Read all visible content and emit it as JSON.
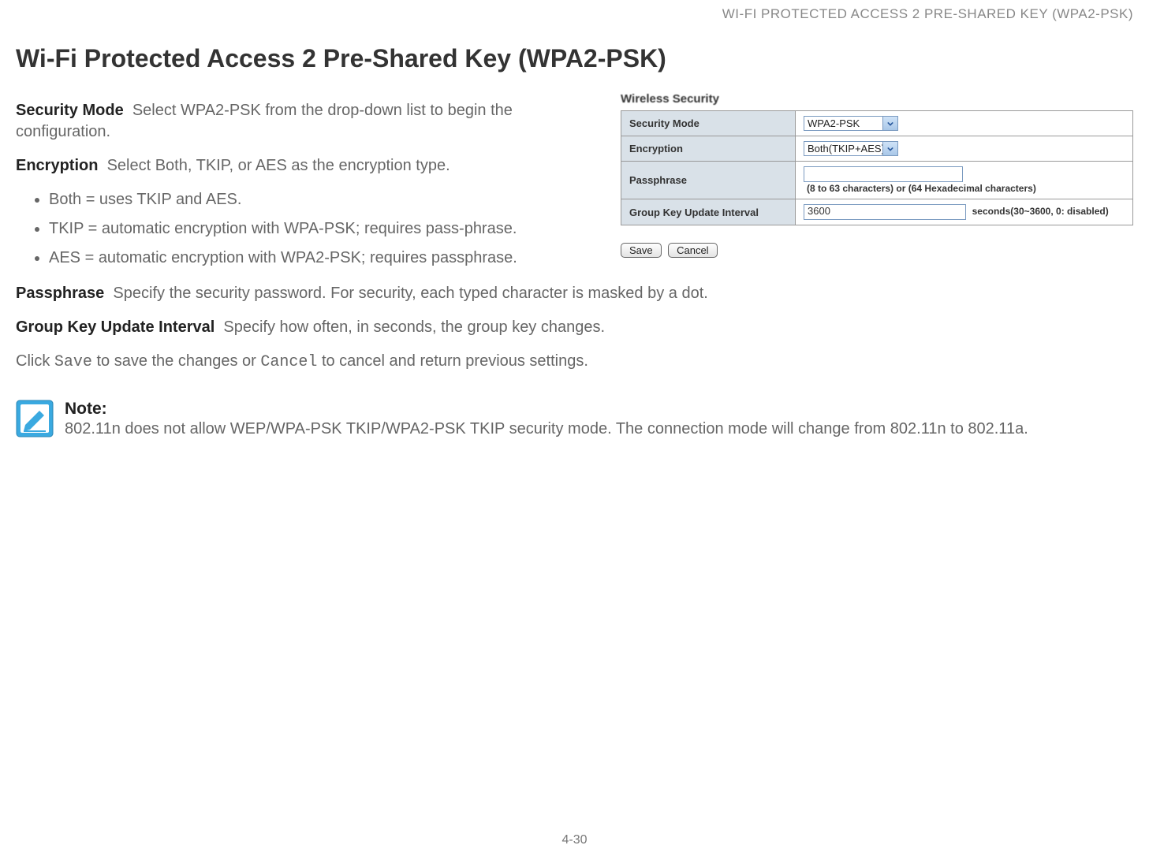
{
  "running_header": "WI-FI PROTECTED ACCESS 2 PRE-SHARED KEY (WPA2-PSK)",
  "page_title": "Wi-Fi Protected Access 2 Pre-Shared Key (WPA2-PSK)",
  "screenshot": {
    "panel_title": "Wireless Security",
    "rows": {
      "security_mode": {
        "label": "Security Mode",
        "value": "WPA2-PSK"
      },
      "encryption": {
        "label": "Encryption",
        "value": "Both(TKIP+AES)"
      },
      "passphrase": {
        "label": "Passphrase",
        "hint": "(8 to 63 characters) or (64 Hexadecimal characters)"
      },
      "group_key": {
        "label": "Group Key Update Interval",
        "value": "3600",
        "hint": "seconds(30~3600, 0: disabled)"
      }
    },
    "buttons": {
      "save": "Save",
      "cancel": "Cancel"
    }
  },
  "paragraphs": {
    "security_mode": {
      "term": "Security Mode",
      "text": "Select WPA2-PSK from the drop-down list to begin the configuration."
    },
    "encryption": {
      "term": "Encryption",
      "text": "Select Both, TKIP, or AES as the encryption type."
    },
    "bullets": [
      "Both = uses TKIP and AES.",
      "TKIP = automatic encryption with WPA-PSK; requires pass-phrase.",
      "AES = automatic encryption with WPA2-PSK; requires passphrase."
    ],
    "passphrase": {
      "term": "Passphrase",
      "text": "Specify the security password. For security, each typed character is masked by a dot."
    },
    "group_key": {
      "term": "Group Key Update Interval",
      "text": "Specify how often, in seconds, the group key changes."
    },
    "click_line": {
      "pre": "Click ",
      "save": "Save",
      "mid": " to save the changes or ",
      "cancel": "Cancel",
      "post": " to cancel and return previous settings."
    }
  },
  "note": {
    "title": "Note:",
    "body": "802.11n does not allow WEP/WPA-PSK TKIP/WPA2-PSK TKIP security mode. The connection mode will change from 802.11n to 802.11a."
  },
  "page_number": "4-30"
}
